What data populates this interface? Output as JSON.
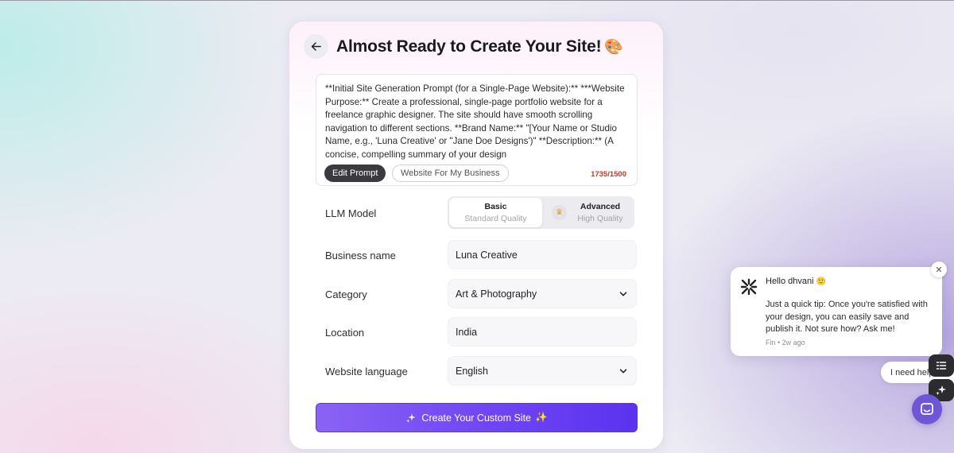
{
  "page": {
    "title": "Almost Ready to Create Your Site!",
    "title_emoji": "🎨"
  },
  "prompt": {
    "text": "**Initial Site Generation Prompt (for a Single-Page Website):** ***Website Purpose:** Create a professional, single-page portfolio website for a freelance graphic designer. The site should have smooth scrolling navigation to different sections. **Brand Name:** \"[Your Name or Studio Name, e.g., 'Luna Creative' or \"Jane Doe Designs')\" **Description:** (A concise, compelling summary of your design",
    "edit_label": "Edit Prompt",
    "preset_label": "Website For My Business",
    "counter": "1735/1500"
  },
  "form": {
    "llm_label": "LLM Model",
    "model_options": [
      {
        "title": "Basic",
        "subtitle": "Standard Quality"
      },
      {
        "title": "Advanced",
        "subtitle": "High Quality"
      }
    ],
    "selected_model": "Basic",
    "business_label": "Business name",
    "business_value": "Luna Creative",
    "category_label": "Category",
    "category_value": "Art & Photography",
    "location_label": "Location",
    "location_value": "India",
    "language_label": "Website language",
    "language_value": "English"
  },
  "create_button": {
    "label": "Create Your Custom Site",
    "leading_icon": "sparkle-icon",
    "trailing_emoji": "✨"
  },
  "chat": {
    "greeting": "Hello dhvani",
    "greeting_emoji": "🙂",
    "message": "Just a quick tip: Once you're satisfied with your design, you can easily save and publish it. Not sure how? Ask me!",
    "meta": "Fin • 2w ago",
    "help_label": "I need help"
  },
  "colors": {
    "accent_start": "#8a63f5",
    "accent_end": "#5b33f0",
    "counter_warning": "#c0392b",
    "launcher": "#6f56d6"
  }
}
